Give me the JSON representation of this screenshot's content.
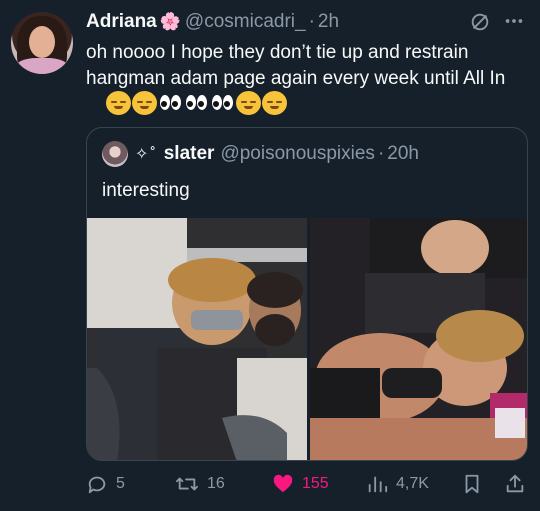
{
  "author": {
    "name": "Adriana",
    "flower_emoji": "🌸",
    "handle": "@cosmicadri_",
    "separator": "·",
    "time": "2h"
  },
  "tweet": {
    "text": "oh noooo I hope they don’t tie up and restrain hangman adam page again every week until All In"
  },
  "quoted": {
    "sparkles": "✧˚",
    "name": "slater",
    "handle": "@poisonouspixies",
    "separator": "·",
    "time": "20h",
    "text": "interesting"
  },
  "actions": {
    "replies": "5",
    "retweets": "16",
    "likes": "155",
    "views": "4,7K"
  },
  "colors": {
    "background": "#15202b",
    "like_pink": "#f91880",
    "muted": "#8b98a5"
  }
}
